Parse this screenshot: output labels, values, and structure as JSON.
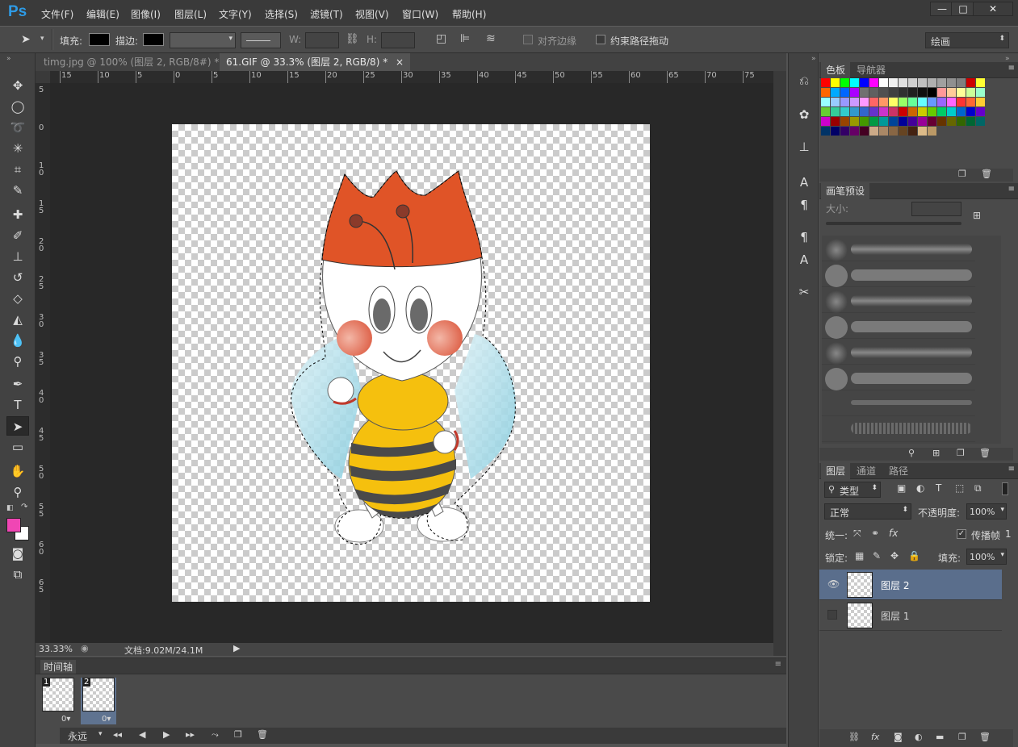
{
  "app": {
    "logo": "Ps"
  },
  "menu": [
    "文件(F)",
    "编辑(E)",
    "图像(I)",
    "图层(L)",
    "文字(Y)",
    "选择(S)",
    "滤镜(T)",
    "视图(V)",
    "窗口(W)",
    "帮助(H)"
  ],
  "window_controls": {
    "minimize": "—",
    "maximize": "□",
    "close": "✕"
  },
  "options": {
    "fill_label": "填充:",
    "stroke_label": "描边:",
    "w_label": "W:",
    "h_label": "H:",
    "align_edges": "对齐边缘",
    "constrain_path": "约束路径拖动",
    "workspace": "绘画"
  },
  "tabs": [
    {
      "label": "timg.jpg @ 100% (图层 2, RGB/8#) *",
      "close": "×"
    },
    {
      "label": "61.GIF @ 33.3% (图层 2, RGB/8) *",
      "close": "×"
    }
  ],
  "ruler_h": [
    "15",
    "10",
    "5",
    "0",
    "5",
    "10",
    "15",
    "20",
    "25",
    "30",
    "35",
    "40",
    "45",
    "50",
    "55",
    "60",
    "65",
    "70",
    "75"
  ],
  "ruler_v": [
    "5",
    "0",
    "1 0",
    "1 5",
    "2 0",
    "2 5",
    "3 0",
    "3 5",
    "4 0",
    "4 5",
    "5 0",
    "5 5",
    "6 0",
    "6 5"
  ],
  "status": {
    "zoom": "33.33%",
    "doc_info": "文档:9.02M/24.1M"
  },
  "timeline": {
    "title": "时间轴",
    "frames": [
      {
        "num": "1",
        "delay": "0▾"
      },
      {
        "num": "2",
        "delay": "0▾"
      }
    ],
    "loop": "永远"
  },
  "panels": {
    "swatches_tab": "色板",
    "navigator_tab": "导航器",
    "brush_presets_tab": "画笔预设",
    "size_label": "大小:",
    "layers_tab": "图层",
    "channels_tab": "通道",
    "paths_tab": "路径",
    "kind_filter": "类型",
    "blend_mode": "正常",
    "opacity_label": "不透明度:",
    "opacity_value": "100%",
    "unify_label": "统一:",
    "propagate_label": "传播帧",
    "propagate_value": "1",
    "lock_label": "锁定:",
    "fill_label": "填充:",
    "fill_value": "100%",
    "layers": [
      {
        "name": "图层 2",
        "visible": true,
        "selected": true
      },
      {
        "name": "图层 1",
        "visible": false,
        "selected": false
      }
    ]
  },
  "colors": {
    "foreground": "#f046b4",
    "background": "#ffffff",
    "accent": "#2e9be6"
  },
  "swatch_colors": [
    "#ff0000",
    "#ffff00",
    "#00ff00",
    "#00ffff",
    "#0000ff",
    "#ff00ff",
    "#ffffff",
    "#f0f0f0",
    "#e0e0e0",
    "#d0d0d0",
    "#c0c0c0",
    "#b0b0b0",
    "#a0a0a0",
    "#909090",
    "#808080",
    "#cc0000",
    "#ffff33",
    "#ff6600",
    "#00aaff",
    "#0066ff",
    "#aa00ff",
    "#707070",
    "#606060",
    "#505050",
    "#404040",
    "#303030",
    "#202020",
    "#101010",
    "#000000",
    "#ff9999",
    "#ffcc99",
    "#ffff99",
    "#ccff99",
    "#99ffcc",
    "#99ffff",
    "#99ccff",
    "#9999ff",
    "#cc99ff",
    "#ff99ff",
    "#ff6666",
    "#ff9966",
    "#ffff66",
    "#99ff66",
    "#66ff99",
    "#66ffff",
    "#6699ff",
    "#9966ff",
    "#ff66ff",
    "#ff3333",
    "#ff6633",
    "#ffcc33",
    "#66cc33",
    "#33cc99",
    "#33cccc",
    "#3399cc",
    "#3366cc",
    "#6633cc",
    "#cc33cc",
    "#cc3366",
    "#cc0000",
    "#cc6600",
    "#cccc00",
    "#66cc00",
    "#00cc66",
    "#00cccc",
    "#0066cc",
    "#0000cc",
    "#6600cc",
    "#cc00cc",
    "#990000",
    "#994400",
    "#999900",
    "#449900",
    "#009944",
    "#009999",
    "#004499",
    "#000099",
    "#440099",
    "#990099",
    "#660033",
    "#663300",
    "#666600",
    "#336600",
    "#006633",
    "#006666",
    "#003366",
    "#000066",
    "#330066",
    "#660066",
    "#440022",
    "#ccaa88",
    "#aa8866",
    "#886644",
    "#664422",
    "#442211",
    "#ddbb88",
    "#bb9966"
  ],
  "tools": [
    "move-tool",
    "marquee-tool",
    "lasso-tool",
    "magic-wand-tool",
    "crop-tool",
    "eyedropper-tool",
    "healing-tool",
    "brush-tool",
    "stamp-tool",
    "history-brush-tool",
    "eraser-tool",
    "paint-bucket-tool",
    "blur-tool",
    "dodge-tool",
    "pen-tool",
    "type-tool",
    "path-selection-tool",
    "shape-tool",
    "hand-tool",
    "zoom-tool"
  ]
}
